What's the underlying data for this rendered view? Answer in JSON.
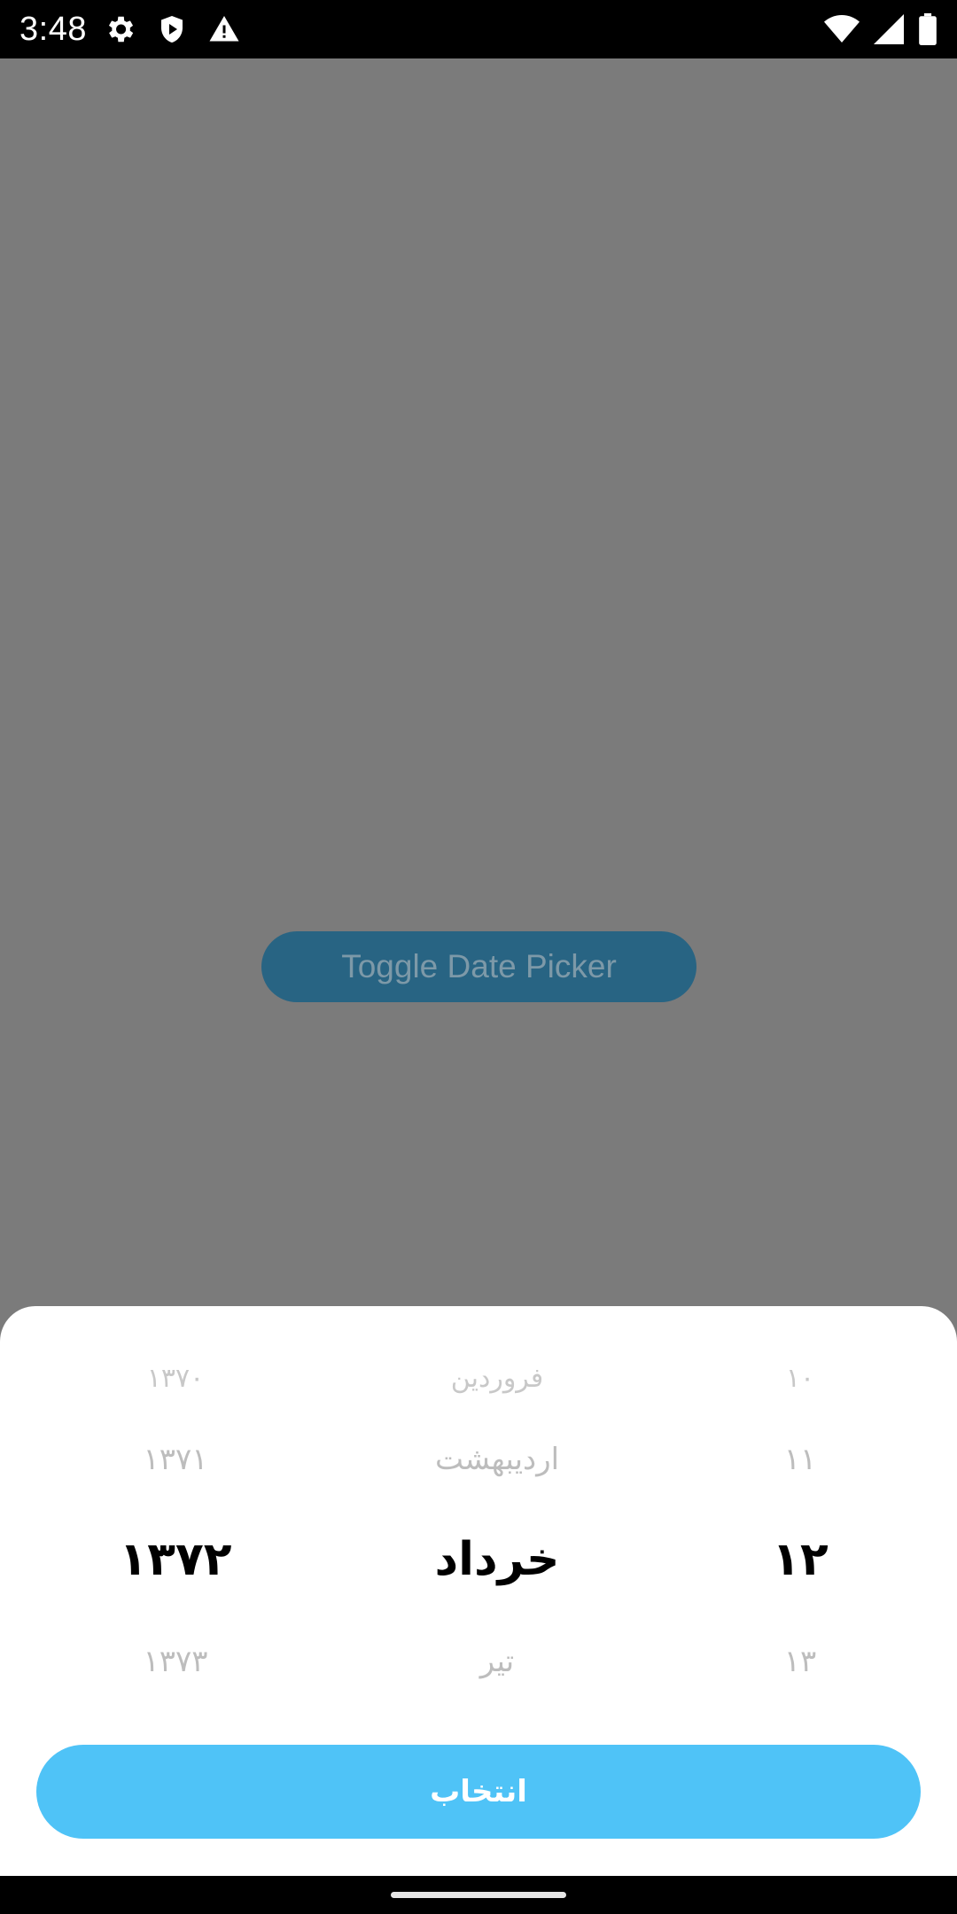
{
  "status_bar": {
    "time": "3:48",
    "left_icons": [
      "gear-icon",
      "shield-play-icon",
      "warning-icon"
    ],
    "right_icons": [
      "wifi-icon",
      "cell-signal-icon",
      "battery-icon"
    ]
  },
  "main": {
    "toggle_button_label": "Toggle Date Picker"
  },
  "date_picker": {
    "year": {
      "far_prev": "۱۳۷۰",
      "prev": "۱۳۷۱",
      "selected": "۱۳۷۲",
      "next": "۱۳۷۳"
    },
    "month": {
      "far_prev": "فروردین",
      "prev": "اردیبهشت",
      "selected": "خرداد",
      "next": "تیر"
    },
    "day": {
      "far_prev": "۱۰",
      "prev": "۱۱",
      "selected": "۱۲",
      "next": "۱۳"
    },
    "select_button_label": "انتخاب"
  },
  "colors": {
    "overlay_background": "#7b7b7b",
    "toggle_button": "#286483",
    "accent": "#4fc3f7",
    "sheet_background": "#ffffff",
    "muted_text": "#c8c8c8"
  }
}
